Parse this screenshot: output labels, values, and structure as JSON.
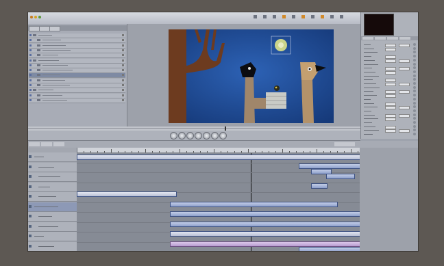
{
  "colors": {
    "frame_bg": "#5d5853",
    "canvas_bg": "#1f4a96",
    "clip_blue": "#8ea0cc",
    "clip_purple": "#b79bd0",
    "playhead": "#0d0d0d"
  },
  "icons": [
    "layer-visibility-icon",
    "layer-thumbnail-icon",
    "transport-play-icon",
    "transport-rewind-icon",
    "transport-forward-icon",
    "keyframe-icon"
  ],
  "canvas_scene": {
    "description_free": true,
    "elements": [
      "tree",
      "left-bird-figure",
      "right-bird-figure",
      "sun-disc",
      "nest-with-chick"
    ]
  },
  "layers": [
    {
      "kind": "group"
    },
    {
      "kind": "layer"
    },
    {
      "kind": "layer"
    },
    {
      "kind": "layer"
    },
    {
      "kind": "layer"
    },
    {
      "kind": "group"
    },
    {
      "kind": "layer"
    },
    {
      "kind": "layer"
    },
    {
      "kind": "layer",
      "selected": true
    },
    {
      "kind": "layer"
    },
    {
      "kind": "layer"
    },
    {
      "kind": "group"
    },
    {
      "kind": "layer"
    },
    {
      "kind": "layer"
    }
  ],
  "tracks": [
    {
      "kind": "group"
    },
    {
      "kind": "layer"
    },
    {
      "kind": "layer"
    },
    {
      "kind": "layer"
    },
    {
      "kind": "layer"
    },
    {
      "kind": "group",
      "selected": true
    },
    {
      "kind": "layer"
    },
    {
      "kind": "layer"
    },
    {
      "kind": "group"
    },
    {
      "kind": "layer"
    }
  ]
}
